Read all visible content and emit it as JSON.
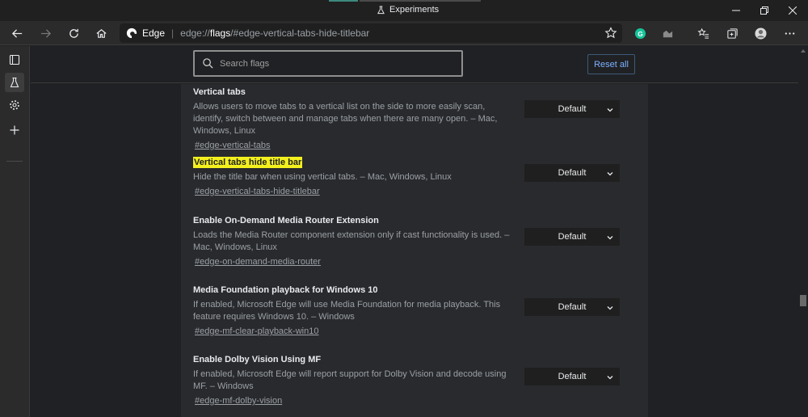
{
  "window": {
    "title": "Experiments",
    "controls": [
      "minimize",
      "restore",
      "close"
    ]
  },
  "toolbar": {
    "address_brand": "Edge",
    "url_scheme": "edge://",
    "url_host": "flags",
    "url_path": "/#edge-vertical-tabs-hide-titlebar",
    "extension_grammarly_letter": "G"
  },
  "sidebar": {
    "items": [
      "tabs-icon",
      "experiments-icon",
      "settings-icon",
      "add-icon"
    ]
  },
  "search": {
    "placeholder": "Search flags",
    "value": ""
  },
  "reset_all_label": "Reset all",
  "flags": [
    {
      "title": "Vertical tabs",
      "highlighted": false,
      "description": "Allows users to move tabs to a vertical list on the side to more easily scan, identify, switch between and manage tabs when there are many open. – Mac, Windows, Linux",
      "link": "#edge-vertical-tabs",
      "value": "Default"
    },
    {
      "title": "Vertical tabs hide title bar",
      "highlighted": true,
      "description": "Hide the title bar when using vertical tabs. – Mac, Windows, Linux",
      "link": "#edge-vertical-tabs-hide-titlebar",
      "value": "Default"
    },
    {
      "title": "Enable On-Demand Media Router Extension",
      "highlighted": false,
      "description": "Loads the Media Router component extension only if cast functionality is used. – Mac, Windows, Linux",
      "link": "#edge-on-demand-media-router",
      "value": "Default"
    },
    {
      "title": "Media Foundation playback for Windows 10",
      "highlighted": false,
      "description": "If enabled, Microsoft Edge will use Media Foundation for media playback. This feature requires Windows 10. – Windows",
      "link": "#edge-mf-clear-playback-win10",
      "value": "Default"
    },
    {
      "title": "Enable Dolby Vision Using MF",
      "highlighted": false,
      "description": "If enabled, Microsoft Edge will report support for Dolby Vision and decode using MF. – Windows",
      "link": "#edge-mf-dolby-vision",
      "value": "Default"
    }
  ],
  "colors": {
    "highlight": "#f3f01e",
    "accent_link": "#7cb1ff",
    "background": "#202124",
    "panel": "#292a2d"
  }
}
